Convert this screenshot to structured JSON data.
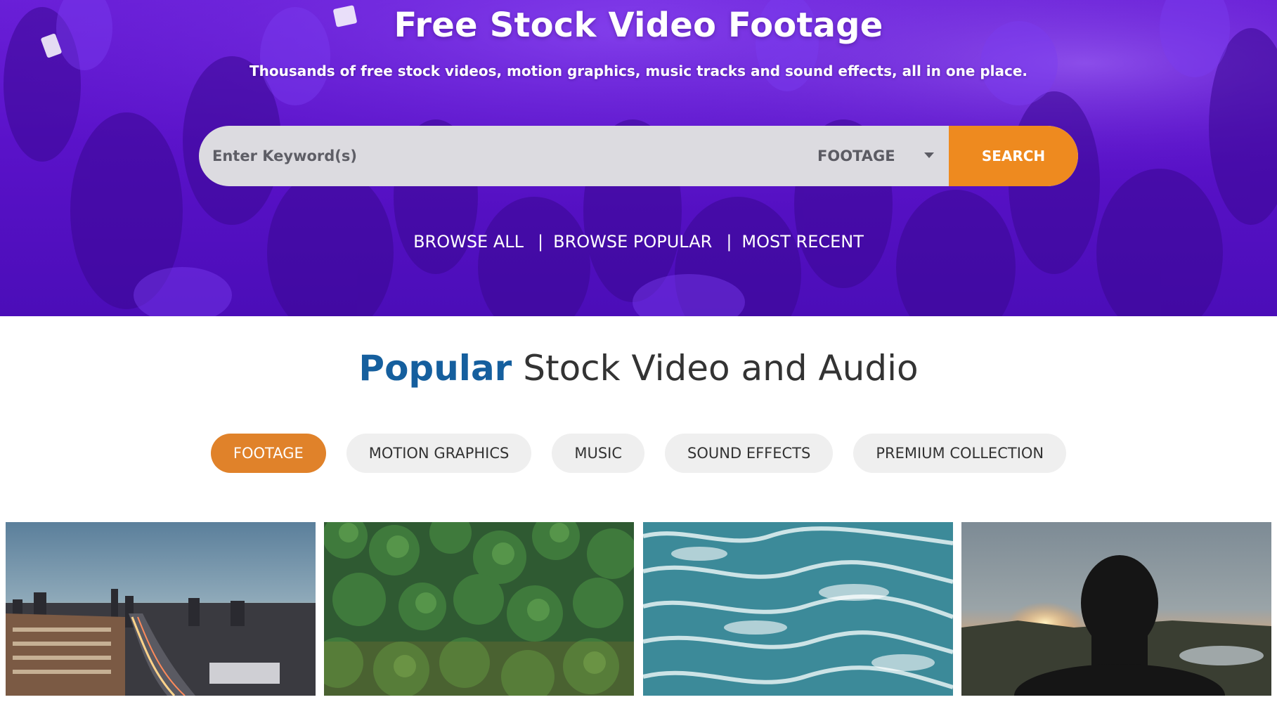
{
  "hero": {
    "title": "Free Stock Video Footage",
    "subtitle": "Thousands of free stock videos, motion graphics, music tracks and sound effects, all in one place.",
    "search": {
      "placeholder": "Enter Keyword(s)",
      "value": "",
      "type_selected": "FOOTAGE",
      "button_label": "SEARCH"
    },
    "browse_links": [
      {
        "label": "BROWSE ALL"
      },
      {
        "label": "BROWSE POPULAR"
      },
      {
        "label": "MOST RECENT"
      }
    ],
    "separator": "|"
  },
  "popular": {
    "title_accent": "Popular",
    "title_rest": " Stock Video and Audio",
    "tabs": [
      {
        "label": "FOOTAGE",
        "active": true
      },
      {
        "label": "MOTION GRAPHICS",
        "active": false
      },
      {
        "label": "MUSIC",
        "active": false
      },
      {
        "label": "SOUND EFFECTS",
        "active": false
      },
      {
        "label": "PREMIUM COLLECTION",
        "active": false
      }
    ],
    "thumbnails": [
      {
        "subject": "city-highway-sunset"
      },
      {
        "subject": "aerial-forest"
      },
      {
        "subject": "ocean-waves"
      },
      {
        "subject": "person-silhouette-sunset"
      }
    ]
  },
  "colors": {
    "hero_purple": "#5a12c9",
    "search_orange": "#ee8a1f",
    "tab_active_orange": "#e0822a",
    "title_accent_blue": "#155f9e"
  }
}
